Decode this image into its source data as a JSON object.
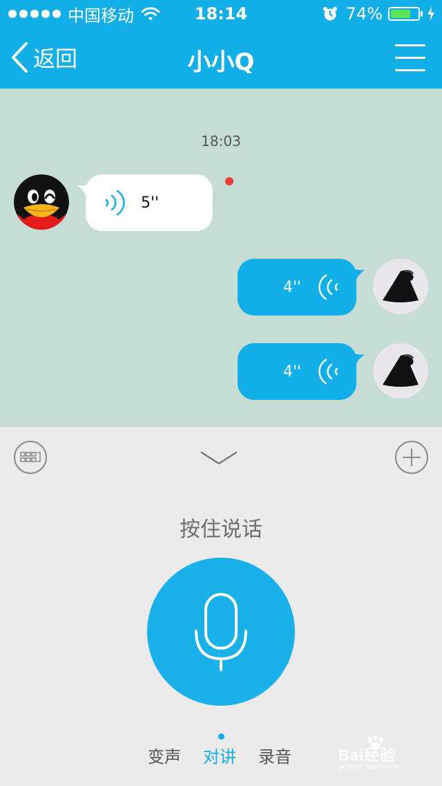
{
  "status_bar": {
    "carrier": "中国移动",
    "time": "18:14",
    "battery_percent_text": "74%",
    "battery_level": 0.74
  },
  "nav": {
    "back_label": "返回",
    "title": "小小Q"
  },
  "chat": {
    "timestamp": "18:03",
    "messages": [
      {
        "side": "left",
        "duration": "5''",
        "unread": true
      },
      {
        "side": "right",
        "duration": "4''"
      },
      {
        "side": "right",
        "duration": "4''"
      }
    ]
  },
  "voice_panel": {
    "hold_to_talk": "按住说话",
    "modes": [
      "变声",
      "对讲",
      "录音"
    ],
    "active_mode": "对讲"
  },
  "watermark": {
    "logo_text": "Bai经验",
    "url_text": "jingyan.baidu.com"
  },
  "colors": {
    "accent": "#12aee8",
    "chat_bg": "#c6ddd5",
    "panel_bg": "#ebebeb",
    "unread": "#f23b3b"
  }
}
